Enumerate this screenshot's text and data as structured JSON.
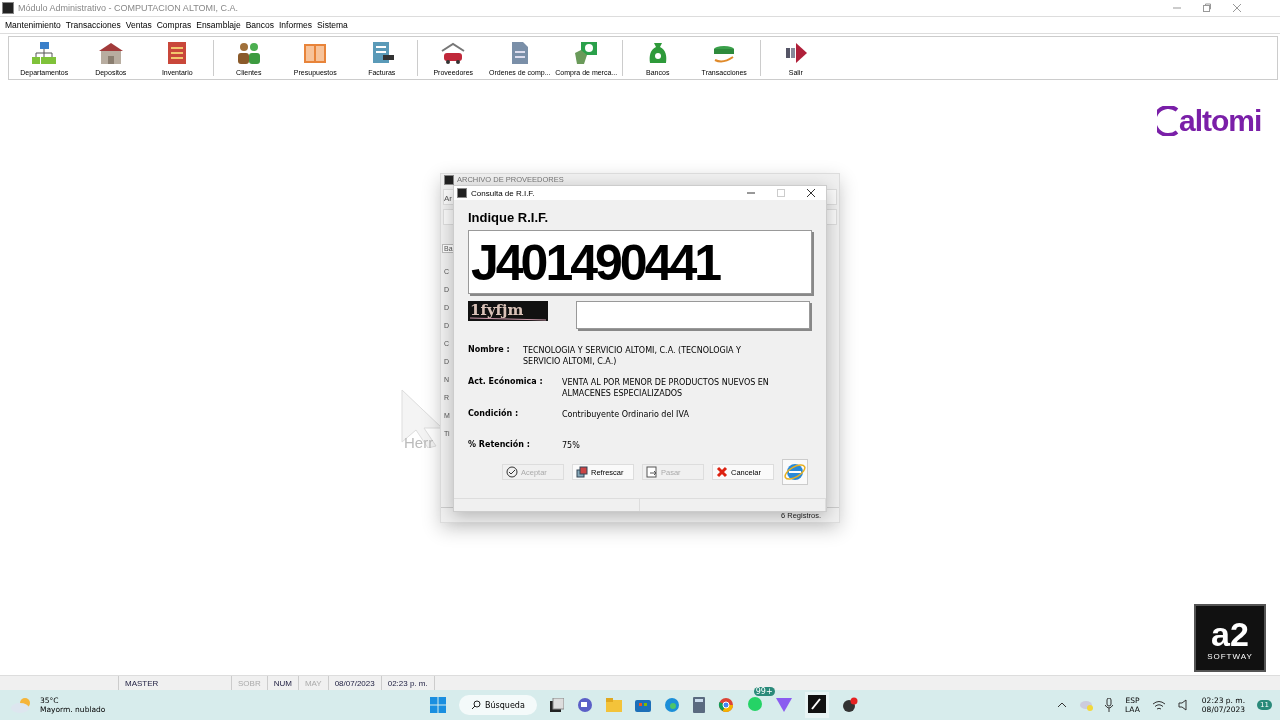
{
  "window": {
    "title": "Módulo Administrativo - COMPUTACION ALTOMI, C.A."
  },
  "menu": [
    "Mantenimiento",
    "Transacciones",
    "Ventas",
    "Compras",
    "Ensamblaje",
    "Bancos",
    "Informes",
    "Sistema"
  ],
  "toolbar": {
    "groups": [
      [
        {
          "label": "Departamentos"
        },
        {
          "label": "Depositos"
        },
        {
          "label": "Inventario"
        }
      ],
      [
        {
          "label": "Clientes"
        },
        {
          "label": "Presupuestos"
        },
        {
          "label": "Facturas"
        }
      ],
      [
        {
          "label": "Proveedores"
        },
        {
          "label": "Ordenes de comp..."
        },
        {
          "label": "Compra de merca..."
        }
      ],
      [
        {
          "label": "Bancos"
        },
        {
          "label": "Transacciones"
        }
      ],
      [
        {
          "label": "Salir"
        }
      ]
    ]
  },
  "brand_logo": {
    "text": "altomi"
  },
  "background_art": {
    "text": "Herr"
  },
  "back_window": {
    "title": "ARCHIVO DE PROVEEDORES",
    "menu_fragment": "Ar",
    "tab_fragment": "Ba",
    "label_fragments": [
      "C",
      "D",
      "D",
      "D",
      "C",
      "D",
      "N",
      "R",
      "M",
      "Ti"
    ],
    "status": "6 Registros."
  },
  "dialog": {
    "title": "Consulta de R.I.F.",
    "prompt": "Indique R.I.F.",
    "rif_value": "J401490441",
    "captcha": "1fyfjm",
    "fields": [
      {
        "label": "Nombre :",
        "value": "TECNOLOGIA Y SERVICIO ALTOMI, C.A. (TECNOLOGIA Y SERVICIO ALTOMI, C.A.)",
        "kind": "short"
      },
      {
        "label": "Act. Ecónomica :",
        "value": "VENTA AL POR MENOR DE PRODUCTOS NUEVOS EN ALMACENES ESPECIALIZADOS",
        "kind": "long"
      },
      {
        "label": "Condición :",
        "value": "Contribuyente Ordinario del IVA",
        "kind": "long"
      },
      {
        "label": "% Retención :",
        "value": "75%",
        "kind": "long"
      }
    ],
    "buttons": [
      {
        "label": "Aceptar",
        "disabled": true,
        "kind": "check"
      },
      {
        "label": "Refrescar",
        "disabled": false,
        "kind": "refresh"
      },
      {
        "label": "Pasar",
        "disabled": true,
        "kind": "pass"
      },
      {
        "label": "Cancelar",
        "disabled": false,
        "kind": "cancel"
      }
    ]
  },
  "corner_logo": {
    "text": "a2",
    "subtext": "SOFTWAY"
  },
  "status_bar": [
    {
      "text": "MASTER",
      "enabled": true
    },
    {
      "text": "SOBR",
      "enabled": false
    },
    {
      "text": "NUM",
      "enabled": true
    },
    {
      "text": "MAY",
      "enabled": false
    },
    {
      "text": "08/07/2023",
      "enabled": true
    },
    {
      "text": "02:23 p. m.",
      "enabled": true
    }
  ],
  "taskbar": {
    "temperature": "35°C",
    "weather": "Mayorm. nublado",
    "search": "Búsqueda",
    "badge": "99+",
    "language": "ESP",
    "layout": "LAA",
    "time": "02:23 p. m.",
    "date": "08/07/2023",
    "notifications": "11"
  }
}
